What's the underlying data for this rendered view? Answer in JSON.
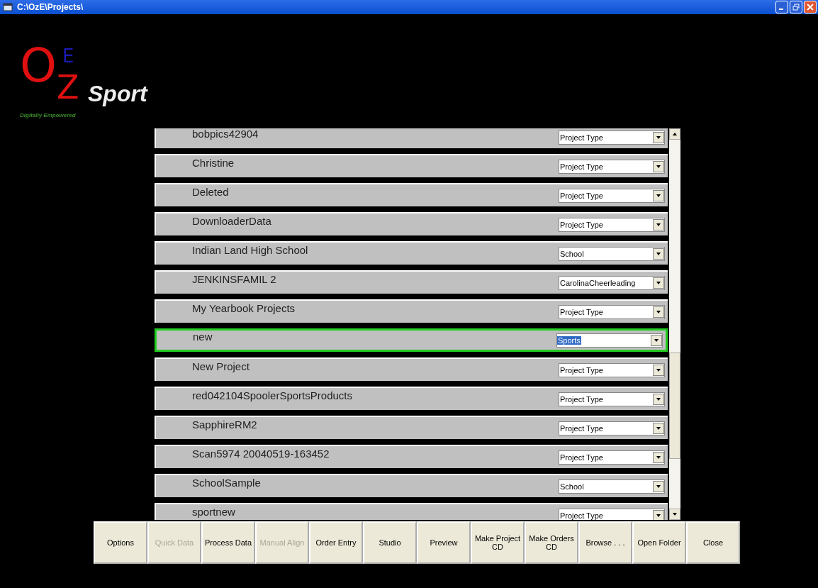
{
  "window": {
    "title": "C:\\OzE\\Projects\\"
  },
  "logo": {
    "letters": [
      "O",
      "Z",
      "E"
    ],
    "word": "Sport",
    "tagline": "Digitally Empowered"
  },
  "projects": [
    {
      "name": "bobpics42904",
      "type": "Project Type",
      "selected": false
    },
    {
      "name": "Christine",
      "type": "Project Type",
      "selected": false
    },
    {
      "name": "Deleted",
      "type": "Project Type",
      "selected": false
    },
    {
      "name": "DownloaderData",
      "type": "Project Type",
      "selected": false
    },
    {
      "name": "Indian Land High School",
      "type": "School",
      "selected": false
    },
    {
      "name": "JENKINSFAMIL 2",
      "type": "CarolinaCheerleading",
      "selected": false
    },
    {
      "name": "My Yearbook Projects",
      "type": "Project Type",
      "selected": false
    },
    {
      "name": "new",
      "type": "Sports",
      "selected": true
    },
    {
      "name": "New Project",
      "type": "Project Type",
      "selected": false
    },
    {
      "name": "red042104SpoolerSportsProducts",
      "type": "Project Type",
      "selected": false
    },
    {
      "name": "SapphireRM2",
      "type": "Project Type",
      "selected": false
    },
    {
      "name": "Scan5974 20040519-163452",
      "type": "Project Type",
      "selected": false
    },
    {
      "name": "SchoolSample",
      "type": "School",
      "selected": false
    },
    {
      "name": "sportnew",
      "type": "Project Type",
      "selected": false
    }
  ],
  "buttons": [
    {
      "label": "Options",
      "disabled": false
    },
    {
      "label": "Quick Data",
      "disabled": true
    },
    {
      "label": "Process Data",
      "disabled": false
    },
    {
      "label": "Manual Align",
      "disabled": true
    },
    {
      "label": "Order Entry",
      "disabled": false
    },
    {
      "label": "Studio",
      "disabled": false
    },
    {
      "label": "Preview",
      "disabled": false
    },
    {
      "label": "Make Project CD",
      "disabled": false
    },
    {
      "label": "Make Orders CD",
      "disabled": false
    },
    {
      "label": "Browse . . .",
      "disabled": false
    },
    {
      "label": "Open Folder",
      "disabled": false
    },
    {
      "label": "Close",
      "disabled": false
    }
  ]
}
